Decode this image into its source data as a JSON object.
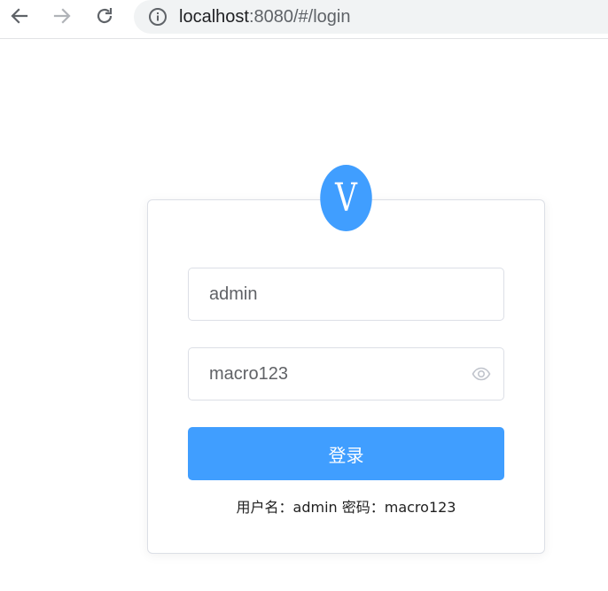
{
  "browser": {
    "url_host": "localhost",
    "url_rest": ":8080/#/login",
    "icons": {
      "back": "arrow-left-icon",
      "forward": "arrow-right-icon",
      "reload": "reload-icon",
      "info": "info-icon"
    }
  },
  "logo": {
    "letter": "V",
    "color": "#409eff"
  },
  "form": {
    "username_value": "admin",
    "password_value": "macro123",
    "password_toggle_icon": "eye-icon",
    "submit_label": "登录",
    "hint": "用户名：admin 密码：macro123"
  },
  "colors": {
    "primary": "#409eff",
    "border": "#dcdfe6",
    "input_text": "#606266"
  }
}
